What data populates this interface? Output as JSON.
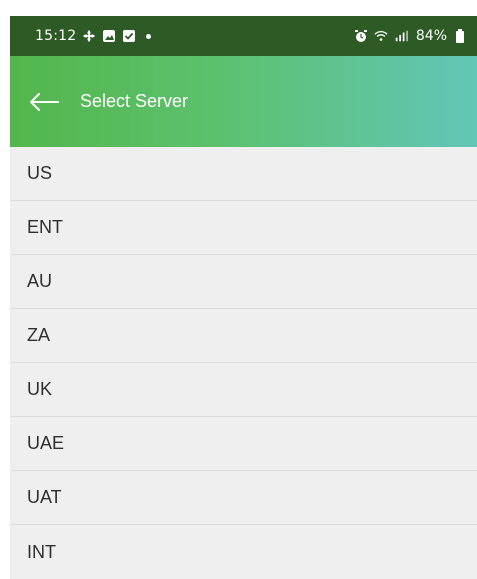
{
  "status_bar": {
    "time": "15:12",
    "battery": "84%",
    "icons": [
      "fan-icon",
      "gallery-icon",
      "checkbox-icon",
      "notification-dot",
      "alarm-icon",
      "wifi-icon",
      "signal-icon",
      "battery-icon"
    ]
  },
  "app_bar": {
    "title": "Select Server",
    "back_icon": "back-arrow-icon"
  },
  "servers": [
    {
      "label": "US"
    },
    {
      "label": "ENT"
    },
    {
      "label": "AU"
    },
    {
      "label": "ZA"
    },
    {
      "label": "UK"
    },
    {
      "label": "UAE"
    },
    {
      "label": "UAT"
    },
    {
      "label": "INT"
    }
  ],
  "colors": {
    "status_bar": "#2e5a26",
    "app_bar_start": "#53b64c",
    "app_bar_end": "#62c6b8",
    "list_background": "#efefef",
    "divider": "#dcdcdc",
    "text": "#2f2f2f"
  }
}
